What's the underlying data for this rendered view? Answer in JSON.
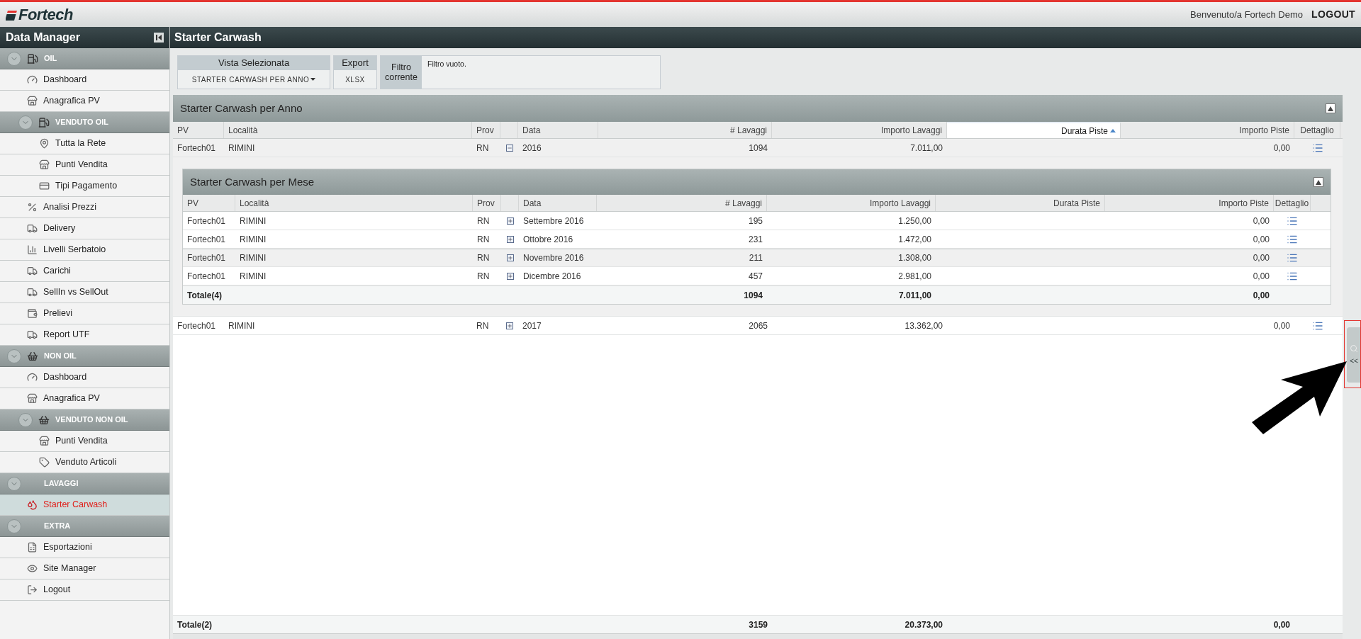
{
  "header": {
    "logo": "Fortech",
    "welcome": "Benvenuto/a Fortech Demo",
    "logout": "LOGOUT"
  },
  "sidebar": {
    "title": "Data Manager",
    "groups": [
      {
        "label": "OIL",
        "children": [
          {
            "label": "Dashboard",
            "selected": false
          },
          {
            "label": "Anagrafica PV",
            "selected": false
          },
          {
            "label": "VENDUTO OIL",
            "children": [
              {
                "label": "Tutta la Rete",
                "selected": false
              },
              {
                "label": "Punti Vendita",
                "selected": false
              },
              {
                "label": "Tipi Pagamento",
                "selected": false
              }
            ]
          },
          {
            "label": "Analisi Prezzi",
            "selected": false
          },
          {
            "label": "Delivery",
            "selected": false
          },
          {
            "label": "Livelli Serbatoio",
            "selected": false
          },
          {
            "label": "Carichi",
            "selected": false
          },
          {
            "label": "SellIn vs SellOut",
            "selected": false
          },
          {
            "label": "Prelievi",
            "selected": false
          },
          {
            "label": "Report UTF",
            "selected": false
          }
        ]
      },
      {
        "label": "NON OIL",
        "children": [
          {
            "label": "Dashboard",
            "selected": false
          },
          {
            "label": "Anagrafica PV",
            "selected": false
          },
          {
            "label": "VENDUTO NON OIL",
            "children": [
              {
                "label": "Punti Vendita",
                "selected": false
              },
              {
                "label": "Venduto Articoli",
                "selected": false
              }
            ]
          }
        ]
      },
      {
        "label": "LAVAGGI",
        "children": [
          {
            "label": "Starter Carwash",
            "selected": true
          }
        ]
      },
      {
        "label": "EXTRA",
        "children": [
          {
            "label": "Esportazioni",
            "selected": false
          },
          {
            "label": "Site Manager",
            "selected": false
          },
          {
            "label": "Logout",
            "selected": false
          }
        ]
      }
    ]
  },
  "main": {
    "title": "Starter Carwash",
    "toolbar": {
      "view_label": "Vista Selezionata",
      "view_value": "STARTER CARWASH PER ANNO",
      "export_label": "Export",
      "export_value": "XLSX",
      "filter_label": "Filtro corrente",
      "filter_text": "Filtro vuoto."
    },
    "grid": {
      "title": "Starter Carwash per Anno",
      "columns": [
        {
          "label": "PV",
          "sorted": false
        },
        {
          "label": "Località",
          "sorted": false
        },
        {
          "label": "Prov",
          "sorted": false
        },
        {
          "label": "Data",
          "sorted": false
        },
        {
          "label": "# Lavaggi",
          "sorted": false
        },
        {
          "label": "Importo Lavaggi",
          "sorted": false
        },
        {
          "label": "Durata Piste",
          "sorted": true
        },
        {
          "label": "Importo Piste",
          "sorted": false
        },
        {
          "label": "Dettaglio",
          "sorted": false
        }
      ],
      "rows": [
        {
          "pv": "Fortech01",
          "localita": "RIMINI",
          "prov": "RN",
          "expanded": true,
          "data": "2016",
          "lavaggi": "1094",
          "importo_lavaggi": "7.011,00",
          "importo_piste": "0,00",
          "detail": {
            "title": "Starter Carwash per Mese",
            "columns": [
              {
                "label": "PV",
                "sorted": false
              },
              {
                "label": "Località",
                "sorted": false
              },
              {
                "label": "Prov",
                "sorted": false
              },
              {
                "label": "Data",
                "sorted": false
              },
              {
                "label": "# Lavaggi",
                "sorted": false
              },
              {
                "label": "Importo Lavaggi",
                "sorted": false
              },
              {
                "label": "Durata Piste",
                "sorted": false
              },
              {
                "label": "Importo Piste",
                "sorted": false
              },
              {
                "label": "Dettaglio",
                "sorted": false
              }
            ],
            "rows": [
              {
                "pv": "Fortech01",
                "localita": "RIMINI",
                "prov": "RN",
                "expanded": false,
                "data": "Settembre 2016",
                "lavaggi": "195",
                "importo_lavaggi": "1.250,00",
                "importo_piste": "0,00",
                "selected": false
              },
              {
                "pv": "Fortech01",
                "localita": "RIMINI",
                "prov": "RN",
                "expanded": false,
                "data": "Ottobre 2016",
                "lavaggi": "231",
                "importo_lavaggi": "1.472,00",
                "importo_piste": "0,00",
                "selected": false
              },
              {
                "pv": "Fortech01",
                "localita": "RIMINI",
                "prov": "RN",
                "expanded": false,
                "data": "Novembre 2016",
                "lavaggi": "211",
                "importo_lavaggi": "1.308,00",
                "importo_piste": "0,00",
                "selected": true
              },
              {
                "pv": "Fortech01",
                "localita": "RIMINI",
                "prov": "RN",
                "expanded": false,
                "data": "Dicembre 2016",
                "lavaggi": "457",
                "importo_lavaggi": "2.981,00",
                "importo_piste": "0,00",
                "selected": false
              }
            ],
            "total": {
              "label": "Totale(4)",
              "lavaggi": "1094",
              "importo_lavaggi": "7.011,00",
              "importo_piste": "0,00"
            }
          }
        },
        {
          "pv": "Fortech01",
          "localita": "RIMINI",
          "prov": "RN",
          "expanded": false,
          "data": "2017",
          "lavaggi": "2065",
          "importo_lavaggi": "13.362,00",
          "importo_piste": "0,00"
        }
      ],
      "total": {
        "label": "Totale(2)",
        "lavaggi": "3159",
        "importo_lavaggi": "20.373,00",
        "importo_piste": "0,00"
      }
    },
    "side_tab": {
      "text": "<<"
    }
  }
}
